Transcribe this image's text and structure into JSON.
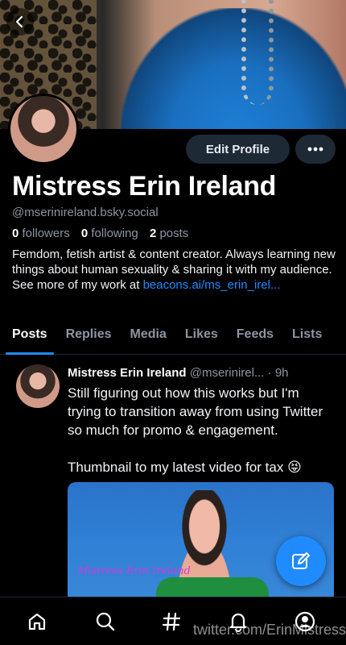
{
  "profile": {
    "display_name": "Mistress Erin Ireland",
    "handle": "@mserinireland.bsky.social",
    "followers_count": "0",
    "followers_label": "followers",
    "following_count": "0",
    "following_label": "following",
    "posts_count": "2",
    "posts_label": "posts",
    "bio_line1": "Femdom, fetish artist & content creator. Always learning new things about human sexuality & sharing it with my audience.",
    "bio_line2_prefix": "See more of my work at ",
    "bio_link": "beacons.ai/ms_erin_irel..."
  },
  "actions": {
    "edit_profile": "Edit Profile",
    "more_icon": "more-horizontal-icon",
    "back_icon": "chevron-left-icon"
  },
  "tabs": [
    {
      "label": "Posts",
      "active": true
    },
    {
      "label": "Replies",
      "active": false
    },
    {
      "label": "Media",
      "active": false
    },
    {
      "label": "Likes",
      "active": false
    },
    {
      "label": "Feeds",
      "active": false
    },
    {
      "label": "Lists",
      "active": false
    }
  ],
  "post": {
    "author_name": "Mistress Erin Ireland",
    "author_handle": "@mserinirel...",
    "time": "· 9h",
    "text_p1": "Still figuring out how this works but I'm trying to transition away from using Twitter so much for promo & engagement.",
    "text_p2": "Thumbnail to my latest video for tax 😝",
    "thumbnail_watermark": "Mistress Erin Ireland"
  },
  "bottom_nav": [
    "home-icon",
    "search-icon",
    "hashtag-icon",
    "bell-icon",
    "profile-icon"
  ],
  "overlay_watermark": "twitter.com/ErinMistress",
  "colors": {
    "background": "#000000",
    "accent": "#208bfe",
    "muted_text": "#8a96a3",
    "button_bg": "#1e2936"
  }
}
